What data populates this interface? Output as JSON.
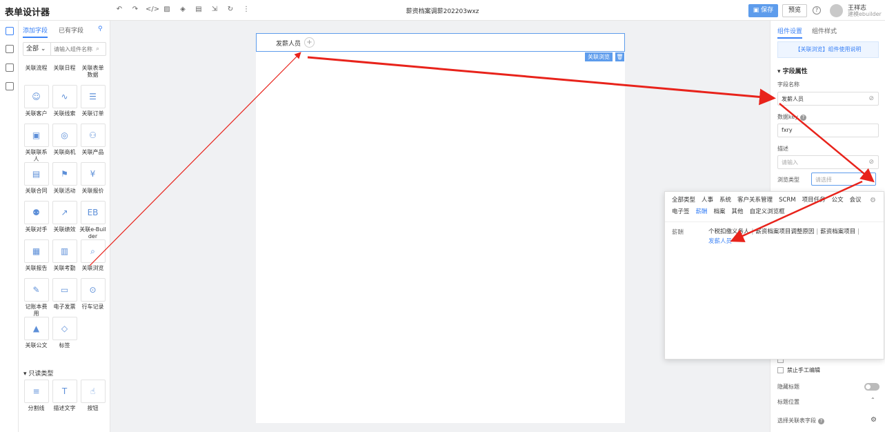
{
  "topbar": {
    "app_title": "表单设计器",
    "doc_title": "薪资档案调薪202203wxz",
    "save_label": "保存",
    "preview_label": "预览",
    "user_name": "王祥志",
    "user_tenant": "建模ebuilder",
    "toolbar_icons": [
      "undo-icon",
      "redo-icon",
      "code-icon",
      "image-icon",
      "layers-icon",
      "save-draft-icon",
      "import-icon",
      "history-icon",
      "more-icon"
    ]
  },
  "palette": {
    "tab_add": "添加字段",
    "tab_existing": "已有字段",
    "filter_select": "全部",
    "filter_placeholder": "请输入组件名称",
    "items": [
      {
        "label": "关联流程",
        "glyph": ""
      },
      {
        "label": "关联日程",
        "glyph": ""
      },
      {
        "label": "关联表单数据",
        "glyph": ""
      },
      {
        "label": "关联客户",
        "glyph": "☺"
      },
      {
        "label": "关联线索",
        "glyph": "∿"
      },
      {
        "label": "关联订单",
        "glyph": "☰"
      },
      {
        "label": "关联联系人",
        "glyph": "▣"
      },
      {
        "label": "关联商机",
        "glyph": "◎"
      },
      {
        "label": "关联产品",
        "glyph": "⚇"
      },
      {
        "label": "关联合同",
        "glyph": "▤"
      },
      {
        "label": "关联活动",
        "glyph": "⚑"
      },
      {
        "label": "关联报价",
        "glyph": "¥"
      },
      {
        "label": "关联对手",
        "glyph": "⚉"
      },
      {
        "label": "关联绩效",
        "glyph": "↗"
      },
      {
        "label": "关联e-Builder",
        "glyph": "EB"
      },
      {
        "label": "关联报告",
        "glyph": "▦"
      },
      {
        "label": "关联考勤",
        "glyph": "▥"
      },
      {
        "label": "关联浏览",
        "glyph": "⌕"
      },
      {
        "label": "记账本费用",
        "glyph": "✎"
      },
      {
        "label": "电子发票",
        "glyph": "▭"
      },
      {
        "label": "行车记录",
        "glyph": "⊙"
      },
      {
        "label": "关联公文",
        "glyph": "▲"
      },
      {
        "label": "标签",
        "glyph": "◇"
      }
    ],
    "readonly_section": "只读类型",
    "readonly_items": [
      {
        "label": "分割线",
        "glyph": "≡"
      },
      {
        "label": "描述文字",
        "glyph": "T"
      },
      {
        "label": "按钮",
        "glyph": "☝"
      }
    ]
  },
  "canvas": {
    "field_label": "发薪人员",
    "field_tag": "关联浏览"
  },
  "props": {
    "tab_settings": "组件设置",
    "tab_style": "组件样式",
    "guide_link": "【关联浏览】组件使用说明",
    "section_title": "字段属性",
    "name_label": "字段名称",
    "name_value": "发薪人员",
    "key_label": "数据key",
    "key_value": "fxry",
    "desc_label": "描述",
    "desc_placeholder": "请输入",
    "browse_label": "浏览类型",
    "browse_placeholder": "请选择",
    "disable_manual": "禁止手工编辑",
    "hide_title": "隐藏标题",
    "title_position": "标题位置",
    "choose_fields": "选择关联表字段"
  },
  "popup": {
    "categories": [
      {
        "label": "全部类型",
        "active": false
      },
      {
        "label": "人事",
        "active": false
      },
      {
        "label": "系统",
        "active": false
      },
      {
        "label": "客户关系管理",
        "active": false
      },
      {
        "label": "SCRM",
        "active": false
      },
      {
        "label": "项目任务",
        "active": false
      },
      {
        "label": "公文",
        "active": false
      },
      {
        "label": "会议",
        "active": false
      },
      {
        "label": "电子签",
        "active": false
      },
      {
        "label": "薪酬",
        "active": true
      },
      {
        "label": "档案",
        "active": false
      },
      {
        "label": "其他",
        "active": false
      },
      {
        "label": "自定义浏览框",
        "active": false
      }
    ],
    "group_label": "薪酬",
    "items": [
      "个税扣缴义务人",
      "薪资档案项目调整原因",
      "薪资档案项目"
    ],
    "selected_item": "发薪人员"
  },
  "colors": {
    "accent": "#5d9cec",
    "arrow": "#e8231b"
  }
}
